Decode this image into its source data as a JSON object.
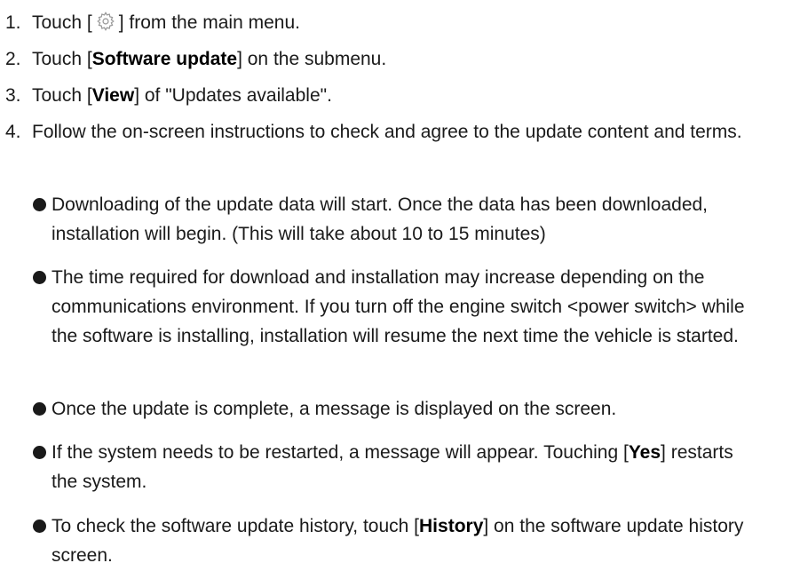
{
  "steps": [
    {
      "num": "1.",
      "pre": "Touch [",
      "icon": "gear-icon",
      "post": "] from the main menu."
    },
    {
      "num": "2.",
      "pre": "Touch [",
      "bold": "Software update",
      "post": "] on the submenu."
    },
    {
      "num": "3.",
      "pre": "Touch [",
      "bold": "View",
      "post": "] of \"Updates available\"."
    },
    {
      "num": "4.",
      "text": "Follow the on-screen instructions to check and agree to the update content and terms."
    }
  ],
  "bullets": [
    {
      "text": "Downloading of the update data will start. Once the data has been downloaded, installation will begin. (This will take about 10 to 15 minutes)"
    },
    {
      "text": "The time required for download and installation may increase depending on the communications environment. If you turn off the engine switch <power switch> while the software is installing, installation will resume the next time the vehicle is started."
    },
    {
      "text": "Once the update is complete, a message is displayed on the screen."
    },
    {
      "pre": "If the system needs to be restarted, a message will appear. Touching [",
      "bold": "Yes",
      "post": "] restarts the system."
    },
    {
      "pre": "To check the software update history, touch [",
      "bold": "History",
      "post": "] on the software update history screen."
    }
  ]
}
